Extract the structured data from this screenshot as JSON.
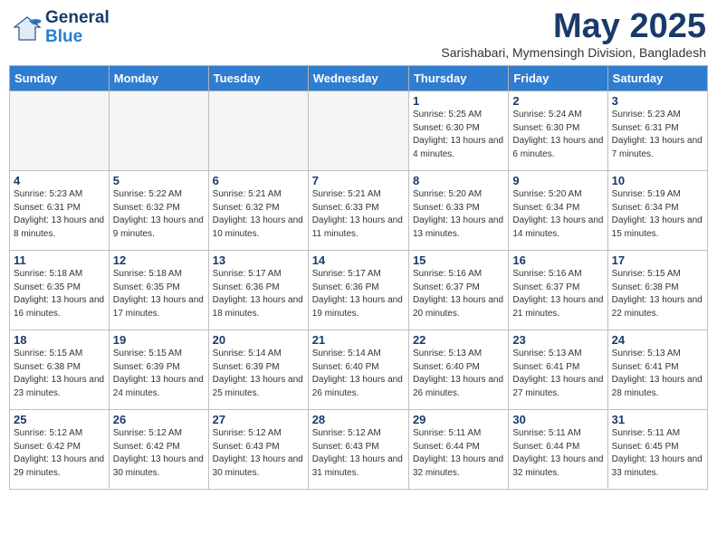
{
  "header": {
    "logo_general": "General",
    "logo_blue": "Blue",
    "title": "May 2025",
    "location": "Sarishabari, Mymensingh Division, Bangladesh"
  },
  "weekdays": [
    "Sunday",
    "Monday",
    "Tuesday",
    "Wednesday",
    "Thursday",
    "Friday",
    "Saturday"
  ],
  "weeks": [
    [
      {
        "day": "",
        "info": ""
      },
      {
        "day": "",
        "info": ""
      },
      {
        "day": "",
        "info": ""
      },
      {
        "day": "",
        "info": ""
      },
      {
        "day": "1",
        "info": "Sunrise: 5:25 AM\nSunset: 6:30 PM\nDaylight: 13 hours\nand 4 minutes."
      },
      {
        "day": "2",
        "info": "Sunrise: 5:24 AM\nSunset: 6:30 PM\nDaylight: 13 hours\nand 6 minutes."
      },
      {
        "day": "3",
        "info": "Sunrise: 5:23 AM\nSunset: 6:31 PM\nDaylight: 13 hours\nand 7 minutes."
      }
    ],
    [
      {
        "day": "4",
        "info": "Sunrise: 5:23 AM\nSunset: 6:31 PM\nDaylight: 13 hours\nand 8 minutes."
      },
      {
        "day": "5",
        "info": "Sunrise: 5:22 AM\nSunset: 6:32 PM\nDaylight: 13 hours\nand 9 minutes."
      },
      {
        "day": "6",
        "info": "Sunrise: 5:21 AM\nSunset: 6:32 PM\nDaylight: 13 hours\nand 10 minutes."
      },
      {
        "day": "7",
        "info": "Sunrise: 5:21 AM\nSunset: 6:33 PM\nDaylight: 13 hours\nand 11 minutes."
      },
      {
        "day": "8",
        "info": "Sunrise: 5:20 AM\nSunset: 6:33 PM\nDaylight: 13 hours\nand 13 minutes."
      },
      {
        "day": "9",
        "info": "Sunrise: 5:20 AM\nSunset: 6:34 PM\nDaylight: 13 hours\nand 14 minutes."
      },
      {
        "day": "10",
        "info": "Sunrise: 5:19 AM\nSunset: 6:34 PM\nDaylight: 13 hours\nand 15 minutes."
      }
    ],
    [
      {
        "day": "11",
        "info": "Sunrise: 5:18 AM\nSunset: 6:35 PM\nDaylight: 13 hours\nand 16 minutes."
      },
      {
        "day": "12",
        "info": "Sunrise: 5:18 AM\nSunset: 6:35 PM\nDaylight: 13 hours\nand 17 minutes."
      },
      {
        "day": "13",
        "info": "Sunrise: 5:17 AM\nSunset: 6:36 PM\nDaylight: 13 hours\nand 18 minutes."
      },
      {
        "day": "14",
        "info": "Sunrise: 5:17 AM\nSunset: 6:36 PM\nDaylight: 13 hours\nand 19 minutes."
      },
      {
        "day": "15",
        "info": "Sunrise: 5:16 AM\nSunset: 6:37 PM\nDaylight: 13 hours\nand 20 minutes."
      },
      {
        "day": "16",
        "info": "Sunrise: 5:16 AM\nSunset: 6:37 PM\nDaylight: 13 hours\nand 21 minutes."
      },
      {
        "day": "17",
        "info": "Sunrise: 5:15 AM\nSunset: 6:38 PM\nDaylight: 13 hours\nand 22 minutes."
      }
    ],
    [
      {
        "day": "18",
        "info": "Sunrise: 5:15 AM\nSunset: 6:38 PM\nDaylight: 13 hours\nand 23 minutes."
      },
      {
        "day": "19",
        "info": "Sunrise: 5:15 AM\nSunset: 6:39 PM\nDaylight: 13 hours\nand 24 minutes."
      },
      {
        "day": "20",
        "info": "Sunrise: 5:14 AM\nSunset: 6:39 PM\nDaylight: 13 hours\nand 25 minutes."
      },
      {
        "day": "21",
        "info": "Sunrise: 5:14 AM\nSunset: 6:40 PM\nDaylight: 13 hours\nand 26 minutes."
      },
      {
        "day": "22",
        "info": "Sunrise: 5:13 AM\nSunset: 6:40 PM\nDaylight: 13 hours\nand 26 minutes."
      },
      {
        "day": "23",
        "info": "Sunrise: 5:13 AM\nSunset: 6:41 PM\nDaylight: 13 hours\nand 27 minutes."
      },
      {
        "day": "24",
        "info": "Sunrise: 5:13 AM\nSunset: 6:41 PM\nDaylight: 13 hours\nand 28 minutes."
      }
    ],
    [
      {
        "day": "25",
        "info": "Sunrise: 5:12 AM\nSunset: 6:42 PM\nDaylight: 13 hours\nand 29 minutes."
      },
      {
        "day": "26",
        "info": "Sunrise: 5:12 AM\nSunset: 6:42 PM\nDaylight: 13 hours\nand 30 minutes."
      },
      {
        "day": "27",
        "info": "Sunrise: 5:12 AM\nSunset: 6:43 PM\nDaylight: 13 hours\nand 30 minutes."
      },
      {
        "day": "28",
        "info": "Sunrise: 5:12 AM\nSunset: 6:43 PM\nDaylight: 13 hours\nand 31 minutes."
      },
      {
        "day": "29",
        "info": "Sunrise: 5:11 AM\nSunset: 6:44 PM\nDaylight: 13 hours\nand 32 minutes."
      },
      {
        "day": "30",
        "info": "Sunrise: 5:11 AM\nSunset: 6:44 PM\nDaylight: 13 hours\nand 32 minutes."
      },
      {
        "day": "31",
        "info": "Sunrise: 5:11 AM\nSunset: 6:45 PM\nDaylight: 13 hours\nand 33 minutes."
      }
    ]
  ]
}
